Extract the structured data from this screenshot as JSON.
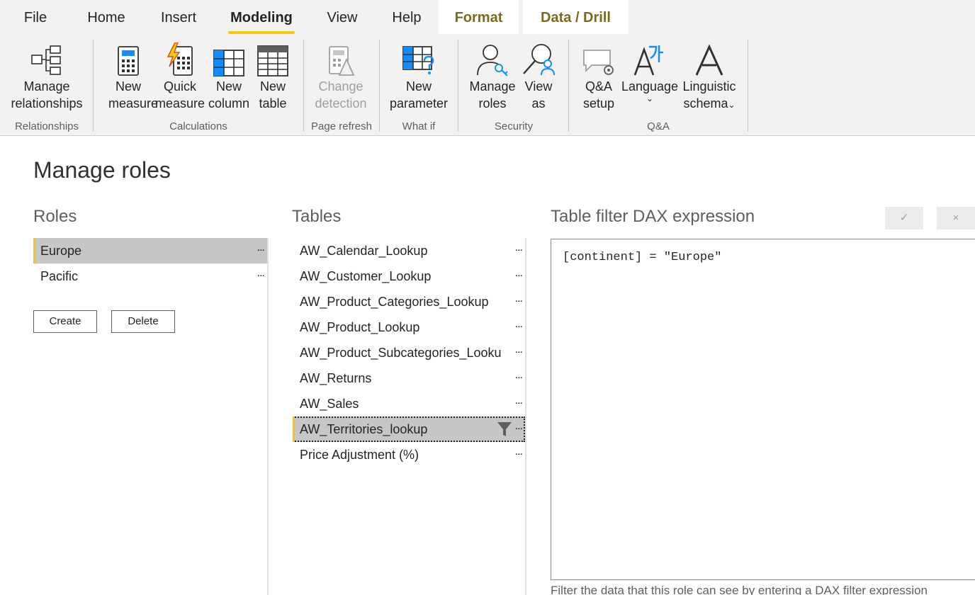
{
  "ribbon": {
    "tabs": [
      "File",
      "Home",
      "Insert",
      "Modeling",
      "View",
      "Help",
      "Format",
      "Data / Drill"
    ],
    "active_tab": "Modeling",
    "buttons": {
      "manage_relationships": [
        "Manage",
        "relationships"
      ],
      "new_measure": [
        "New",
        "measure"
      ],
      "quick_measure": [
        "Quick",
        "measure"
      ],
      "new_column": [
        "New",
        "column"
      ],
      "new_table": [
        "New",
        "table"
      ],
      "change_detection": [
        "Change",
        "detection"
      ],
      "new_parameter": [
        "New",
        "parameter"
      ],
      "manage_roles": [
        "Manage",
        "roles"
      ],
      "view_as": [
        "View",
        "as"
      ],
      "qa_setup": [
        "Q&A",
        "setup"
      ],
      "language": "Language",
      "linguistic_schema": [
        "Linguistic",
        "schema"
      ]
    },
    "groups": {
      "relationships": "Relationships",
      "calculations": "Calculations",
      "page_refresh": "Page refresh",
      "what_if": "What if",
      "security": "Security",
      "qa": "Q&A"
    },
    "colors": {
      "accent": "#f2c811",
      "context_tab_text": "#7a6a1e"
    }
  },
  "dialog": {
    "title": "Manage roles",
    "roles_heading": "Roles",
    "tables_heading": "Tables",
    "dax_heading": "Table filter DAX expression",
    "roles": [
      {
        "name": "Europe",
        "more": "...",
        "selected": true
      },
      {
        "name": "Pacific",
        "more": "...",
        "selected": false
      }
    ],
    "create_label": "Create",
    "delete_label": "Delete",
    "tables": [
      {
        "name": "AW_Calendar_Lookup",
        "more": "..."
      },
      {
        "name": "AW_Customer_Lookup",
        "more": "..."
      },
      {
        "name": "AW_Product_Categories_Lookup",
        "more": "..."
      },
      {
        "name": "AW_Product_Lookup",
        "more": "..."
      },
      {
        "name": "AW_Product_Subcategories_Looku",
        "more": "..."
      },
      {
        "name": "AW_Returns",
        "more": "..."
      },
      {
        "name": "AW_Sales",
        "more": "..."
      },
      {
        "name": "AW_Territories_lookup",
        "more": "...",
        "selected": true,
        "filtered": true
      },
      {
        "name": "Price Adjustment (%)",
        "more": "..."
      }
    ],
    "confirm_icon": "✓",
    "cancel_icon": "×",
    "dax_expression": "[continent] = \"Europe\"",
    "hint": "Filter the data that this role can see by entering a DAX filter expression"
  }
}
